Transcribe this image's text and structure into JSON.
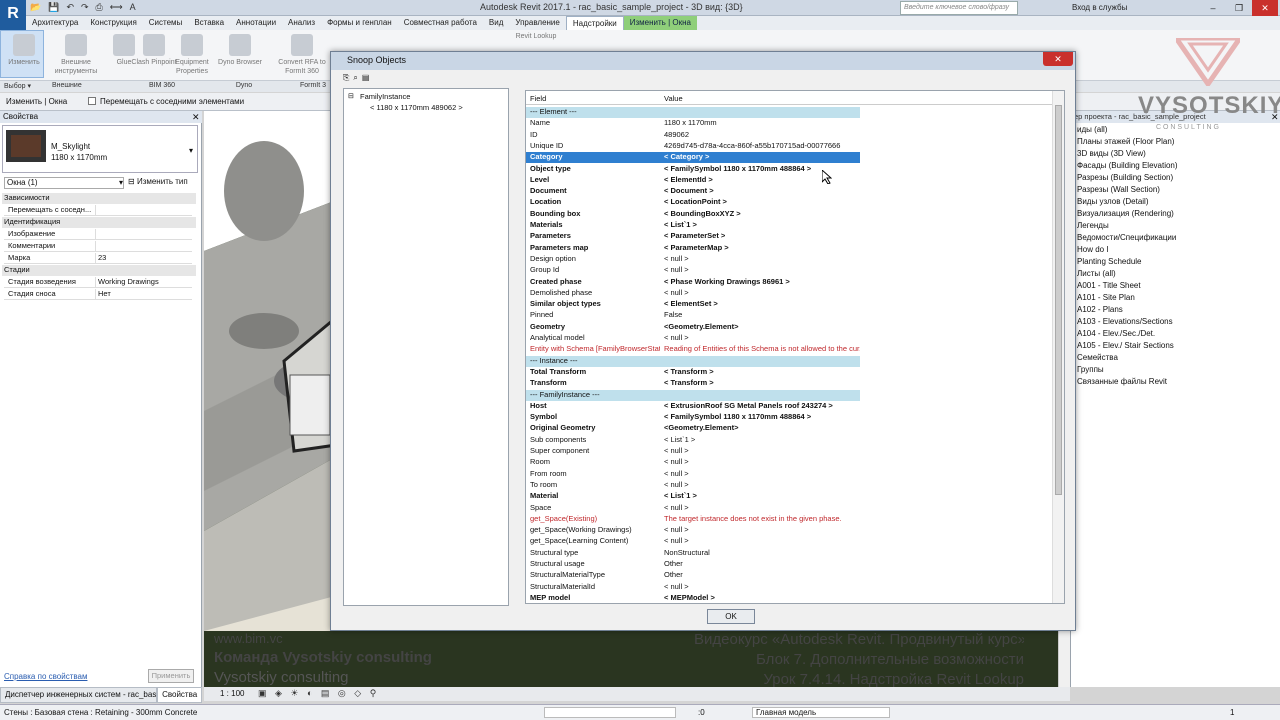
{
  "app": {
    "logo": "R",
    "title": "Autodesk Revit 2017.1 -     rac_basic_sample_project - 3D вид: {3D}",
    "search_placeholder": "Введите ключевое слово/фразу",
    "sign_in": "Вход в службы",
    "qat_icons": [
      "open-icon",
      "save-icon",
      "undo-icon",
      "redo-icon",
      "print-icon",
      "measure-icon",
      "text-icon"
    ]
  },
  "ribbon": {
    "tabs": [
      "Архитектура",
      "Конструкция",
      "Системы",
      "Вставка",
      "Аннотации",
      "Анализ",
      "Формы и генплан",
      "Совместная работа",
      "Вид",
      "Управление",
      "Надстройки",
      "Изменить | Окна"
    ],
    "active_tab": "Надстройки",
    "buttons": [
      {
        "label": "Изменить"
      },
      {
        "label": "Внешние инструменты"
      },
      {
        "label": "Glue"
      },
      {
        "label": "Clash Pinpoint"
      },
      {
        "label": "Equipment Properties"
      },
      {
        "label": "Dyno Browser"
      },
      {
        "label": "Convert RFA to FormIt 360"
      },
      {
        "label": "Revit Lookup"
      }
    ],
    "panels": [
      "Выбор ▾",
      "Внешние",
      "BIM 360",
      "Dyno",
      "FormIt 3"
    ]
  },
  "optbar": {
    "context": "Изменить | Окна",
    "checkbox_label": "Перемещать с соседними элементами"
  },
  "properties": {
    "title": "Свойства",
    "type_name": "M_Skylight",
    "type_size": "1180 x 1170mm",
    "instance_selector": "Окна (1)",
    "edit_type": "Изменить тип",
    "rows": [
      {
        "kind": "section",
        "label": "Зависимости"
      },
      {
        "kind": "row",
        "k": "Перемещать с соседн...",
        "v": ""
      },
      {
        "kind": "section",
        "label": "Идентификация"
      },
      {
        "kind": "row",
        "k": "Изображение",
        "v": ""
      },
      {
        "kind": "row",
        "k": "Комментарии",
        "v": ""
      },
      {
        "kind": "row",
        "k": "Марка",
        "v": "23"
      },
      {
        "kind": "section",
        "label": "Стадии"
      },
      {
        "kind": "row",
        "k": "Стадия возведения",
        "v": "Working Drawings"
      },
      {
        "kind": "row",
        "k": "Стадия сноса",
        "v": "Нет"
      }
    ],
    "help_link": "Справка по свойствам",
    "apply": "Применить"
  },
  "bottom_tabs": [
    "Диспетчер инженерных систем - rac_basi...",
    "Свойства"
  ],
  "viewctl": {
    "scale": "1 : 100"
  },
  "status": {
    "text": "Стены : Базовая стена : Retaining - 300mm Concrete",
    "coord": ":0",
    "model": "Главная модель",
    "filter": "1"
  },
  "browser": {
    "title": "ер проекта - rac_basic_sample_project",
    "items": [
      "иды (all)",
      "Планы этажей (Floor Plan)",
      "3D виды (3D View)",
      "Фасады (Building Elevation)",
      "Разрезы (Building Section)",
      "Разрезы (Wall Section)",
      "Виды узлов (Detail)",
      "Визуализация (Rendering)",
      "Легенды",
      "Ведомости/Спецификации",
      "How do I",
      "Planting Schedule",
      "Листы (all)",
      "A001 - Title Sheet",
      "A101 - Site Plan",
      "A102 - Plans",
      "A103 - Elevations/Sections",
      "A104 - Elev./Sec./Det.",
      "A105 - Elev./ Stair Sections",
      "Семейства",
      "Группы",
      "Связанные файлы Revit"
    ]
  },
  "watermark": {
    "brand": "VYSOTSKIY",
    "brand_sub": "C O N S U L T I N G",
    "left": [
      "www.bim.vc",
      "Команда Vysotskiy consulting",
      "Vysotskiy consulting"
    ],
    "right": [
      "Видеокурс «Autodesk Revit. Продвинутый курс»",
      "Блок 7. Дополнительные возможности",
      "Урок 7.4.14. Надстройка Revit Lookup"
    ]
  },
  "dialog": {
    "title": "Snoop Objects",
    "tree": {
      "root": "FamilyInstance",
      "child": "< 1180 x 1170mm  489062 >"
    },
    "columns": [
      "Field",
      "Value"
    ],
    "rows": [
      {
        "t": "hdr",
        "f": "--- Element ---",
        "v": ""
      },
      {
        "t": "n",
        "f": "Name",
        "v": "1180 x 1170mm"
      },
      {
        "t": "n",
        "f": "ID",
        "v": "489062"
      },
      {
        "t": "n",
        "f": "Unique ID",
        "v": "4269d745-d78a-4cca-860f-a55b170715ad-00077666"
      },
      {
        "t": "sel",
        "f": "Category",
        "v": "< Category >"
      },
      {
        "t": "b",
        "f": "Object type",
        "v": "< FamilySymbol   1180 x 1170mm   488864 >"
      },
      {
        "t": "b",
        "f": "Level",
        "v": "< ElementId >"
      },
      {
        "t": "b",
        "f": "Document",
        "v": "< Document >"
      },
      {
        "t": "b",
        "f": "Location",
        "v": "< LocationPoint >"
      },
      {
        "t": "b",
        "f": "Bounding box",
        "v": "< BoundingBoxXYZ >"
      },
      {
        "t": "b",
        "f": "Materials",
        "v": "< List`1 >"
      },
      {
        "t": "b",
        "f": "Parameters",
        "v": "< ParameterSet >"
      },
      {
        "t": "b",
        "f": "Parameters map",
        "v": "< ParameterMap >"
      },
      {
        "t": "n",
        "f": "Design option",
        "v": "< null >"
      },
      {
        "t": "n",
        "f": "Group Id",
        "v": "< null >"
      },
      {
        "t": "b",
        "f": "Created phase",
        "v": "< Phase   Working Drawings   86961 >"
      },
      {
        "t": "n",
        "f": "Demolished phase",
        "v": "< null >"
      },
      {
        "t": "b",
        "f": "Similar object types",
        "v": "< ElementSet >"
      },
      {
        "t": "n",
        "f": "Pinned",
        "v": "False"
      },
      {
        "t": "b",
        "f": "Geometry",
        "v": "<Geometry.Element>"
      },
      {
        "t": "n",
        "f": "Analytical model",
        "v": "< null >"
      },
      {
        "t": "err",
        "f": "Entity with Schema [FamilyBrowserStat...",
        "v": "Reading of Entities of this Schema is not allowed to the cur..."
      },
      {
        "t": "hdr",
        "f": "--- Instance ---",
        "v": ""
      },
      {
        "t": "b",
        "f": "Total Transform",
        "v": "< Transform >"
      },
      {
        "t": "b",
        "f": "Transform",
        "v": "< Transform >"
      },
      {
        "t": "hdr",
        "f": "--- FamilyInstance ---",
        "v": ""
      },
      {
        "t": "b",
        "f": "Host",
        "v": "< ExtrusionRoof   SG Metal Panels roof   243274 >"
      },
      {
        "t": "b",
        "f": "Symbol",
        "v": "< FamilySymbol   1180 x 1170mm   488864 >"
      },
      {
        "t": "b",
        "f": "Original Geometry",
        "v": "<Geometry.Element>"
      },
      {
        "t": "n",
        "f": "Sub components",
        "v": "< List`1 >"
      },
      {
        "t": "n",
        "f": "Super component",
        "v": "< null >"
      },
      {
        "t": "n",
        "f": "Room",
        "v": "< null >"
      },
      {
        "t": "n",
        "f": "From room",
        "v": "< null >"
      },
      {
        "t": "n",
        "f": "To room",
        "v": "< null >"
      },
      {
        "t": "b",
        "f": "Material",
        "v": "< List`1 >"
      },
      {
        "t": "n",
        "f": "Space",
        "v": "< null >"
      },
      {
        "t": "err",
        "f": "get_Space(Existing)",
        "v": "The target instance does not exist in the given phase."
      },
      {
        "t": "n",
        "f": "get_Space(Working Drawings)",
        "v": "< null >"
      },
      {
        "t": "n",
        "f": "get_Space(Learning Content)",
        "v": "< null >"
      },
      {
        "t": "n",
        "f": "Structural type",
        "v": "NonStructural"
      },
      {
        "t": "n",
        "f": "Structural usage",
        "v": "Other"
      },
      {
        "t": "n",
        "f": "StructuralMaterialType",
        "v": "Other"
      },
      {
        "t": "n",
        "f": "StructuralMaterialId",
        "v": "< null >"
      },
      {
        "t": "b",
        "f": "MEP model",
        "v": "< MEPModel >"
      }
    ],
    "ok": "OK"
  }
}
